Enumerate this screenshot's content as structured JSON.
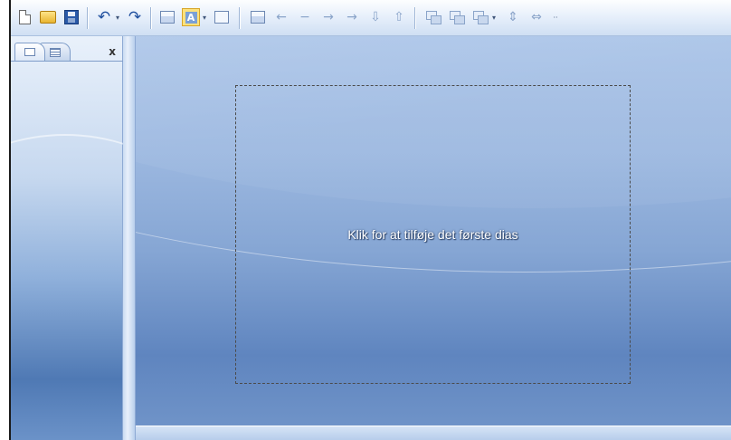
{
  "toolbar": {
    "buttons": [
      {
        "icon": "new-document-icon"
      },
      {
        "icon": "open-folder-icon"
      },
      {
        "icon": "save-icon"
      },
      {
        "icon": "undo-icon",
        "glyph": "↶",
        "dropdown": "▾"
      },
      {
        "icon": "redo-icon",
        "glyph": "↷"
      },
      {
        "icon": "layout-icon"
      },
      {
        "icon": "text-box-icon",
        "glyph": "A",
        "dropdown": "▾"
      },
      {
        "icon": "picture-frame-icon"
      },
      {
        "icon": "notes-icon"
      },
      {
        "icon": "arrow-left-icon",
        "glyph": "←"
      },
      {
        "icon": "minus-icon",
        "glyph": "−"
      },
      {
        "icon": "arrow-right-icon",
        "glyph": "→"
      },
      {
        "icon": "arrow-right-small-icon",
        "glyph": "→"
      },
      {
        "icon": "arrow-down-bar-icon",
        "glyph": "⇩"
      },
      {
        "icon": "arrow-up-bar-icon",
        "glyph": "⇧"
      },
      {
        "icon": "bring-forward-icon"
      },
      {
        "icon": "send-backward-icon"
      },
      {
        "icon": "group-icon",
        "dropdown": "▾"
      },
      {
        "icon": "align-icon",
        "glyph": "⇕"
      },
      {
        "icon": "distribute-icon",
        "glyph": "⇔"
      },
      {
        "icon": "more-icon",
        "glyph": "··"
      }
    ]
  },
  "left_panel": {
    "close_label": "x",
    "tabs": [
      {
        "icon": "slides-tab-icon"
      },
      {
        "icon": "outline-tab-icon"
      }
    ]
  },
  "slide": {
    "placeholder_text": "Klik for at tilføje det første dias"
  },
  "colors": {
    "toolbar_bg": "#e8f0fb",
    "workspace_blue": "#86a6d4",
    "placeholder_border": "#4b4b4b"
  }
}
